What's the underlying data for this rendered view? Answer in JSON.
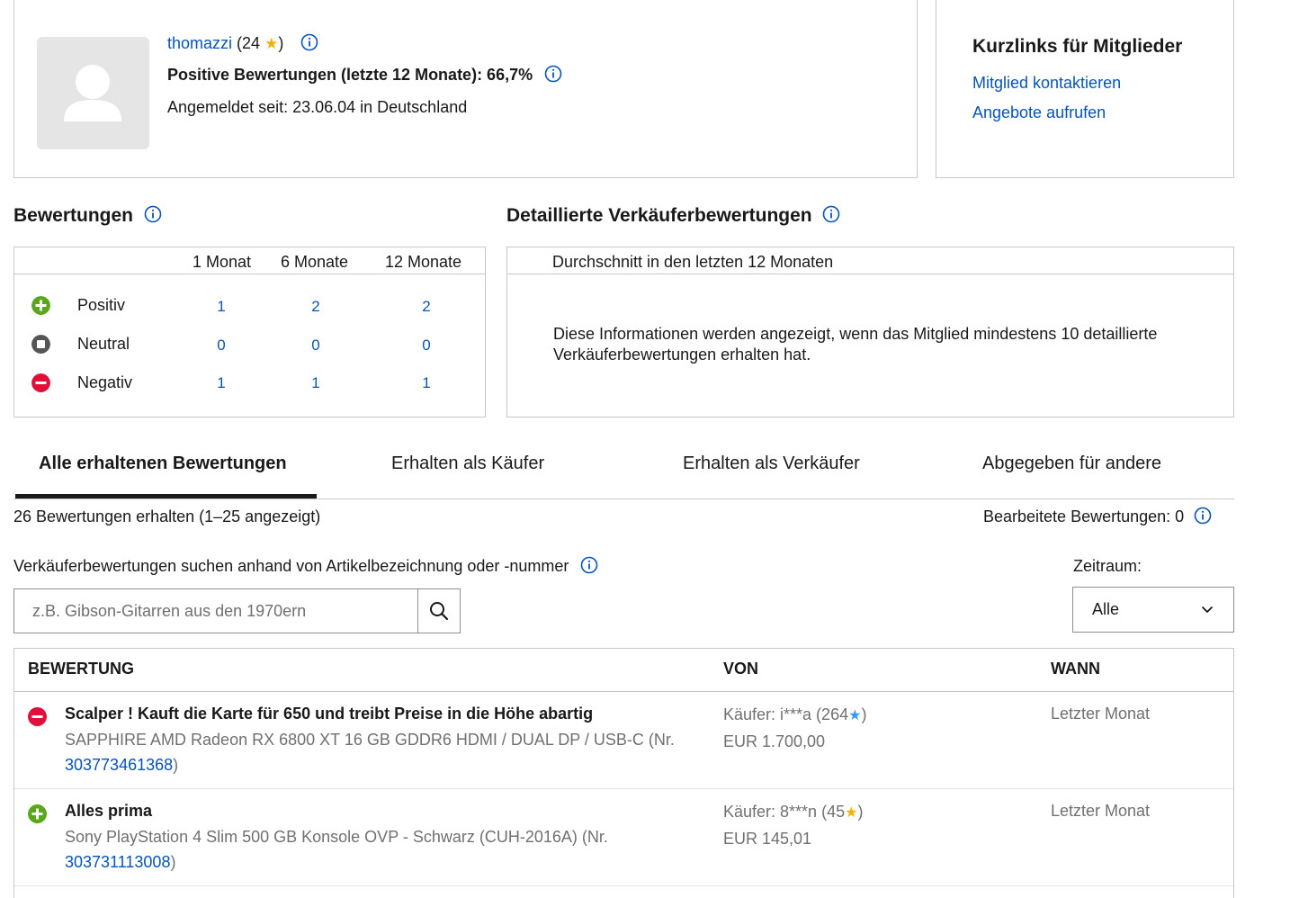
{
  "profile": {
    "username": "thomazzi",
    "score_prefix": "(24",
    "score_suffix": ")",
    "positive_label": "Positive Bewertungen (letzte 12 Monate): 66,7%",
    "member_since": "Angemeldet seit: 23.06.04 in Deutschland"
  },
  "quicklinks": {
    "title": "Kurzlinks für Mitglieder",
    "contact": "Mitglied kontaktieren",
    "offers": "Angebote aufrufen"
  },
  "ratings": {
    "heading": "Bewertungen",
    "columns": [
      "1 Monat",
      "6 Monate",
      "12 Monate"
    ],
    "rows": [
      {
        "label": "Positiv",
        "values": [
          "1",
          "2",
          "2"
        ]
      },
      {
        "label": "Neutral",
        "values": [
          "0",
          "0",
          "0"
        ]
      },
      {
        "label": "Negativ",
        "values": [
          "1",
          "1",
          "1"
        ]
      }
    ]
  },
  "detailed": {
    "heading": "Detaillierte Verkäuferbewertungen",
    "subheading": "Durchschnitt in den letzten 12 Monaten",
    "message": "Diese Informationen werden angezeigt, wenn das Mitglied mindestens 10 detaillierte Verkäuferbewertungen erhalten hat."
  },
  "tabs": [
    {
      "label": "Alle erhaltenen Bewertungen"
    },
    {
      "label": "Erhalten als Käufer"
    },
    {
      "label": "Erhalten als Verkäufer"
    },
    {
      "label": "Abgegeben für andere"
    }
  ],
  "summary": {
    "count": "26 Bewertungen erhalten (1–25 angezeigt)",
    "edited": "Bearbeitete Bewertungen: 0"
  },
  "search": {
    "label": "Verkäuferbewertungen suchen anhand von Artikelbezeichnung oder -nummer",
    "placeholder": "z.B. Gibson-Gitarren aus den 1970ern"
  },
  "period": {
    "label": "Zeitraum:",
    "selected": "Alle"
  },
  "table": {
    "headers": [
      "BEWERTUNG",
      "VON",
      "WANN"
    ],
    "rows": [
      {
        "comment": "Scalper ! Kauft die Karte für 650 und treibt Preise in die Höhe abartig",
        "item": "SAPPHIRE AMD Radeon RX 6800 XT 16 GB GDDR6 HDMI / DUAL DP / USB-C (Nr.",
        "item_number": "303773461368",
        "item_close": ")",
        "from_prefix": "Käufer: i***a (264",
        "from_suffix": ")",
        "price": "EUR 1.700,00",
        "when": "Letzter Monat"
      },
      {
        "comment": "Alles prima",
        "item": "Sony PlayStation 4 Slim 500 GB Konsole OVP - Schwarz (CUH-2016A) (Nr.",
        "item_number": "303731113008",
        "item_close": ")",
        "from_prefix": "Käufer: 8***n (45",
        "from_suffix": ")",
        "price": "EUR 145,01",
        "when": "Letzter Monat"
      }
    ]
  },
  "colors": {
    "link": "#0654ba",
    "positive": "#5ba71b",
    "neutral": "#555555",
    "negative": "#e0103a",
    "star_yellow": "#f5af02",
    "star_blue": "#3399ff"
  }
}
